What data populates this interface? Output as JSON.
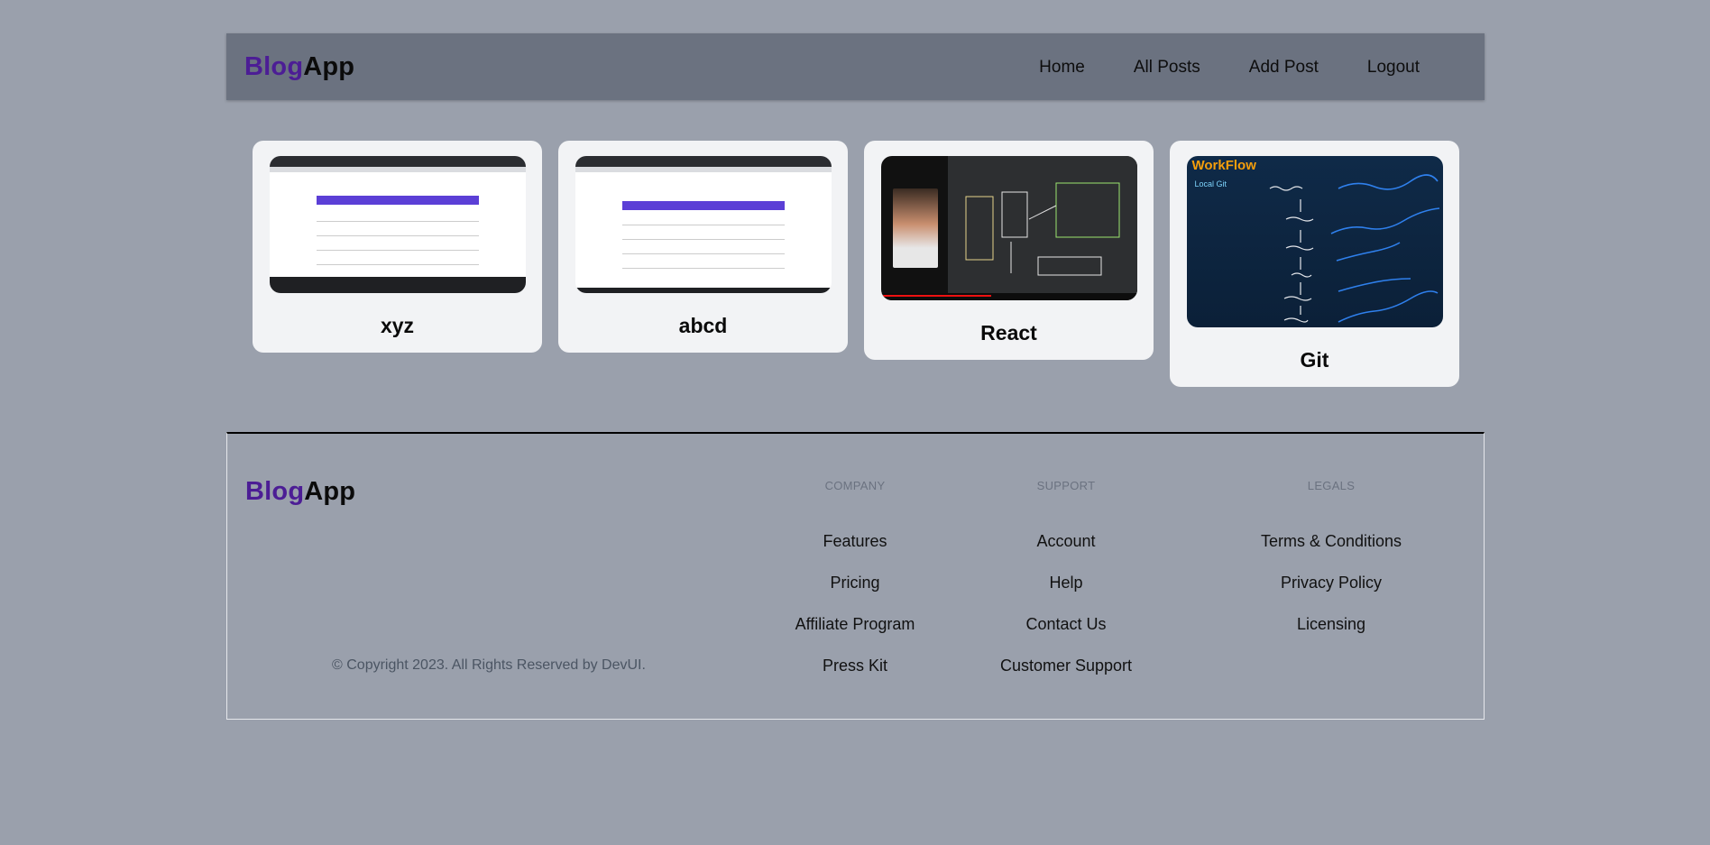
{
  "brand": {
    "part1": "Blog",
    "part2": "App"
  },
  "nav": [
    {
      "label": "Home"
    },
    {
      "label": "All Posts"
    },
    {
      "label": "Add Post"
    },
    {
      "label": "Logout"
    }
  ],
  "posts": [
    {
      "title": "xyz",
      "image": "screenshot-image"
    },
    {
      "title": "abcd",
      "image": "screenshot-image"
    },
    {
      "title": "React",
      "image": "video-thumbnail-image"
    },
    {
      "title": "Git",
      "image": "git-workflow-image",
      "image_text": {
        "heading": "WorkFlow",
        "sub": "Local Git"
      }
    }
  ],
  "footer": {
    "copyright": "© Copyright 2023. All Rights Reserved by DevUI.",
    "columns": [
      {
        "heading": "Company",
        "links": [
          "Features",
          "Pricing",
          "Affiliate Program",
          "Press Kit"
        ]
      },
      {
        "heading": "Support",
        "links": [
          "Account",
          "Help",
          "Contact Us",
          "Customer Support"
        ]
      },
      {
        "heading": "Legals",
        "links": [
          "Terms & Conditions",
          "Privacy Policy",
          "Licensing"
        ]
      }
    ]
  },
  "colors": {
    "background": "#9aa0ac",
    "header": "#6b7280",
    "brand_accent": "#4c1d95",
    "card": "#f2f3f5"
  }
}
